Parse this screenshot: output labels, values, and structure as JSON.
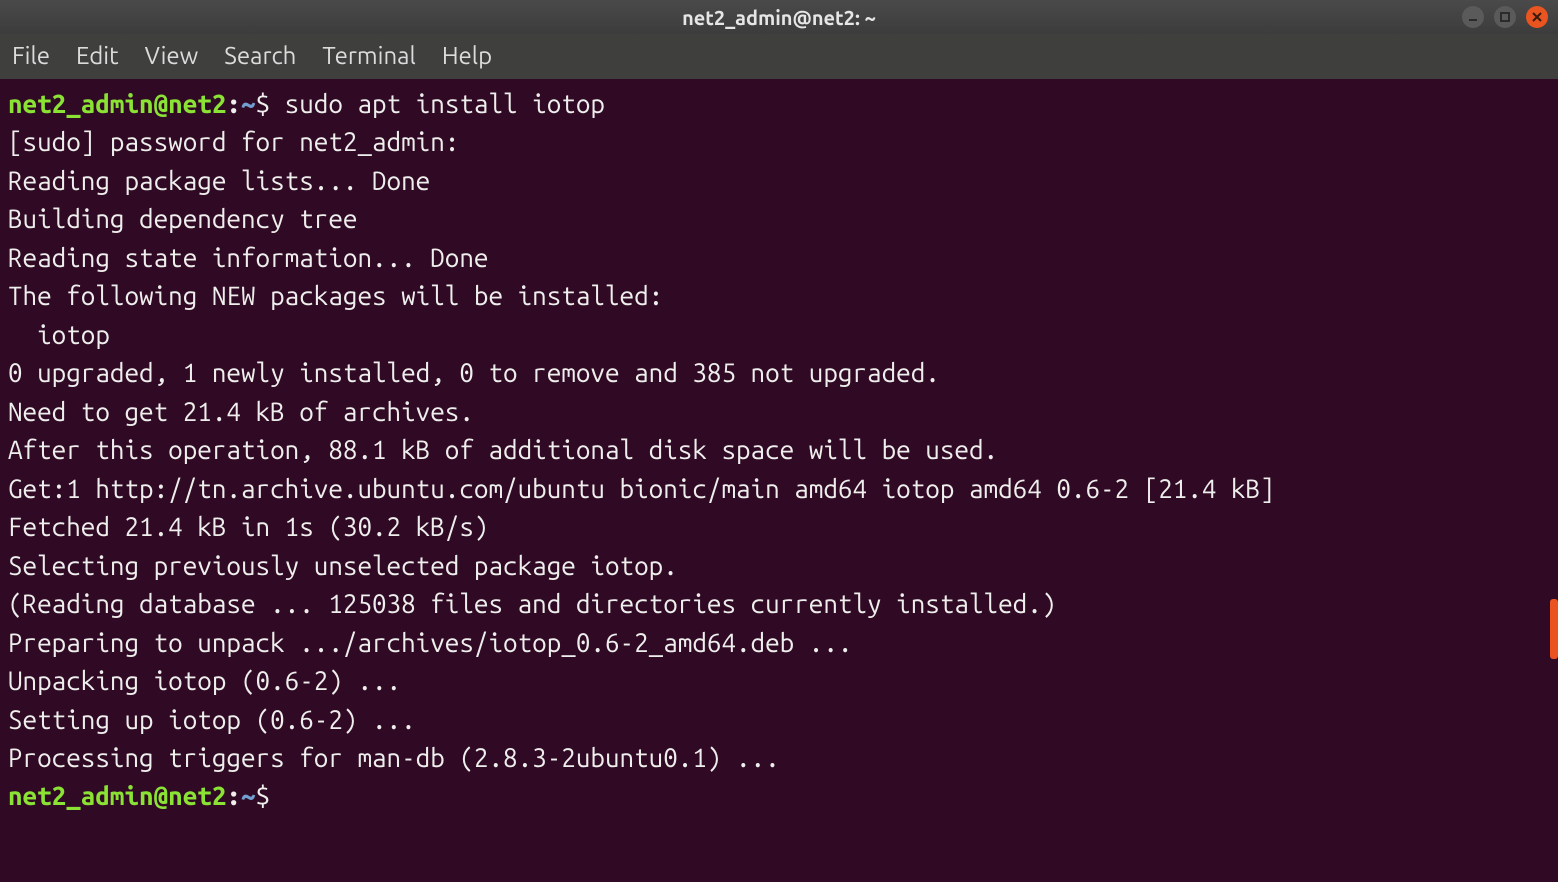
{
  "window": {
    "title": "net2_admin@net2: ~"
  },
  "menubar": {
    "items": [
      "File",
      "Edit",
      "View",
      "Search",
      "Terminal",
      "Help"
    ]
  },
  "prompt": {
    "user": "net2_admin@net2",
    "sep": ":",
    "path": "~",
    "symbol": "$"
  },
  "session": {
    "command": "sudo apt install iotop",
    "output_lines": [
      "[sudo] password for net2_admin:",
      "Reading package lists... Done",
      "Building dependency tree",
      "Reading state information... Done",
      "The following NEW packages will be installed:",
      "  iotop",
      "0 upgraded, 1 newly installed, 0 to remove and 385 not upgraded.",
      "Need to get 21.4 kB of archives.",
      "After this operation, 88.1 kB of additional disk space will be used.",
      "Get:1 http://tn.archive.ubuntu.com/ubuntu bionic/main amd64 iotop amd64 0.6-2 [21.4 kB]",
      "Fetched 21.4 kB in 1s (30.2 kB/s)",
      "Selecting previously unselected package iotop.",
      "(Reading database ... 125038 files and directories currently installed.)",
      "Preparing to unpack .../archives/iotop_0.6-2_amd64.deb ...",
      "Unpacking iotop (0.6-2) ...",
      "Setting up iotop (0.6-2) ...",
      "Processing triggers for man-db (2.8.3-2ubuntu0.1) ..."
    ]
  }
}
